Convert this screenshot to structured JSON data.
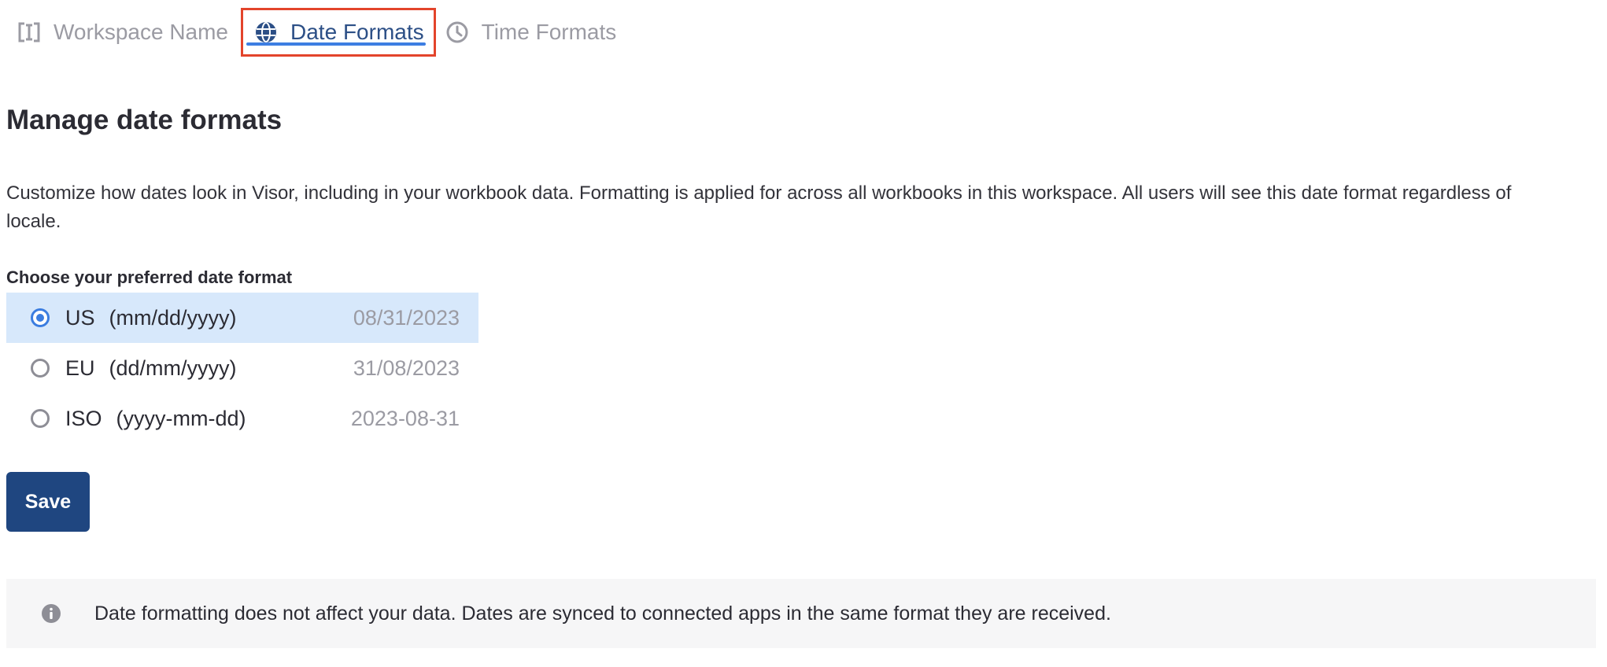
{
  "tabs": {
    "workspace_name": {
      "label": "Workspace Name",
      "icon": "workspace-name-icon"
    },
    "date_formats": {
      "label": "Date Formats",
      "icon": "globe-icon",
      "active": true
    },
    "time_formats": {
      "label": "Time Formats",
      "icon": "clock-icon"
    }
  },
  "page": {
    "title": "Manage date formats",
    "description": "Customize how dates look in Visor, including in your workbook data. Formatting is applied for across all workbooks in this workspace. All users will see this date format regardless of locale."
  },
  "date_format": {
    "label": "Choose your preferred date format",
    "options": [
      {
        "name": "US",
        "pattern": "(mm/dd/yyyy)",
        "example": "08/31/2023",
        "selected": true
      },
      {
        "name": "EU",
        "pattern": "(dd/mm/yyyy)",
        "example": "31/08/2023",
        "selected": false
      },
      {
        "name": "ISO",
        "pattern": "(yyyy-mm-dd)",
        "example": "2023-08-31",
        "selected": false
      }
    ]
  },
  "actions": {
    "save_label": "Save"
  },
  "info": {
    "icon": "info-icon",
    "text": "Date formatting does not affect your data. Dates are synced to connected apps in the same format they are received."
  },
  "colors": {
    "accent": "#3b7de0",
    "primary_button": "#1f4680",
    "active_tab_text": "#2c4f86",
    "highlight_border": "#e3442b",
    "selected_row": "#d7e8fb",
    "muted_text": "#9b9ba3"
  }
}
